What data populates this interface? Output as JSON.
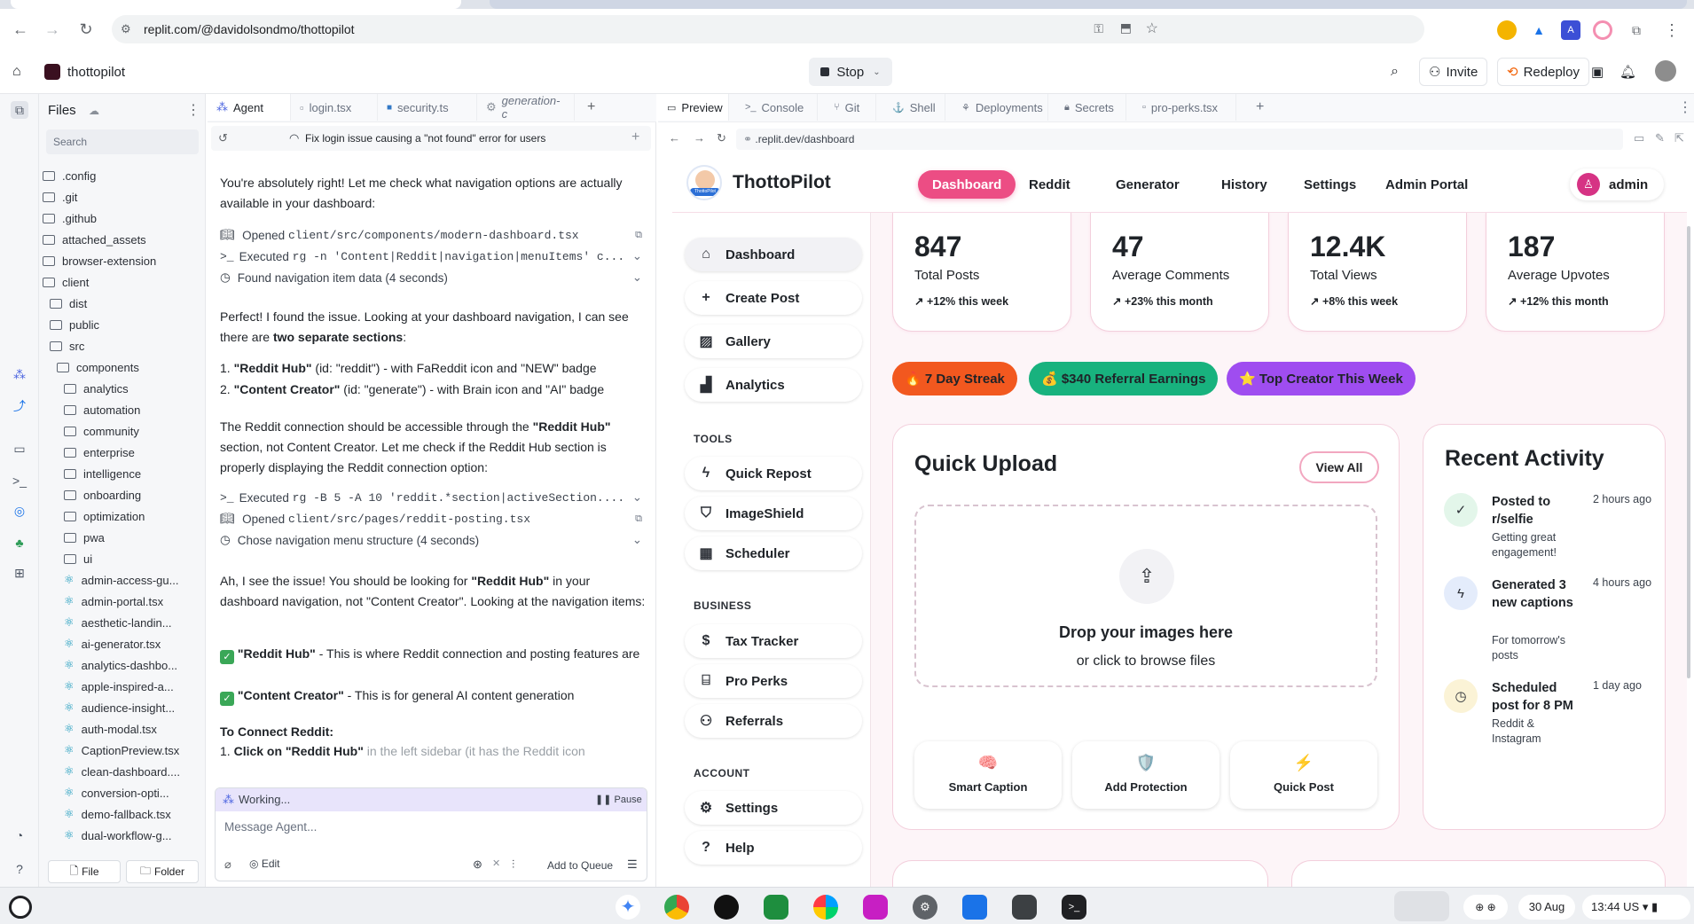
{
  "browser": {
    "url": "replit.com/@davidolsondmo/thottopilot"
  },
  "replit": {
    "project_name": "thottopilot",
    "stop_label": "Stop",
    "invite_label": "Invite",
    "redeploy_label": "Redeploy"
  },
  "files": {
    "title": "Files",
    "search_placeholder": "Search",
    "tree": [
      {
        "name": ".config",
        "type": "folder",
        "depth": 0
      },
      {
        "name": ".git",
        "type": "folder",
        "depth": 0
      },
      {
        "name": ".github",
        "type": "folder",
        "depth": 0
      },
      {
        "name": "attached_assets",
        "type": "folder",
        "depth": 0
      },
      {
        "name": "browser-extension",
        "type": "folder",
        "depth": 0
      },
      {
        "name": "client",
        "type": "folder",
        "depth": 0
      },
      {
        "name": "dist",
        "type": "folder",
        "depth": 1
      },
      {
        "name": "public",
        "type": "folder",
        "depth": 1
      },
      {
        "name": "src",
        "type": "folder",
        "depth": 1
      },
      {
        "name": "components",
        "type": "folder",
        "depth": 2
      },
      {
        "name": "analytics",
        "type": "folder",
        "depth": 3
      },
      {
        "name": "automation",
        "type": "folder",
        "depth": 3
      },
      {
        "name": "community",
        "type": "folder",
        "depth": 3
      },
      {
        "name": "enterprise",
        "type": "folder",
        "depth": 3
      },
      {
        "name": "intelligence",
        "type": "folder",
        "depth": 3
      },
      {
        "name": "onboarding",
        "type": "folder",
        "depth": 3
      },
      {
        "name": "optimization",
        "type": "folder",
        "depth": 3
      },
      {
        "name": "pwa",
        "type": "folder",
        "depth": 3
      },
      {
        "name": "ui",
        "type": "folder",
        "depth": 3
      },
      {
        "name": "admin-access-gu...",
        "type": "file",
        "depth": 3
      },
      {
        "name": "admin-portal.tsx",
        "type": "file",
        "depth": 3
      },
      {
        "name": "aesthetic-landin...",
        "type": "file",
        "depth": 3
      },
      {
        "name": "ai-generator.tsx",
        "type": "file",
        "depth": 3
      },
      {
        "name": "analytics-dashbo...",
        "type": "file",
        "depth": 3
      },
      {
        "name": "apple-inspired-a...",
        "type": "file",
        "depth": 3
      },
      {
        "name": "audience-insight...",
        "type": "file",
        "depth": 3
      },
      {
        "name": "auth-modal.tsx",
        "type": "file",
        "depth": 3
      },
      {
        "name": "CaptionPreview.tsx",
        "type": "file",
        "depth": 3
      },
      {
        "name": "clean-dashboard....",
        "type": "file",
        "depth": 3
      },
      {
        "name": "conversion-opti...",
        "type": "file",
        "depth": 3
      },
      {
        "name": "demo-fallback.tsx",
        "type": "file",
        "depth": 3
      },
      {
        "name": "dual-workflow-g...",
        "type": "file",
        "depth": 3
      }
    ],
    "file_button": "File",
    "folder_button": "Folder"
  },
  "agent": {
    "tabs": [
      "Agent",
      "login.tsx",
      "security.ts",
      "generation-c"
    ],
    "thread_title": "Fix login issue causing a \"not found\" error for users",
    "p1": "You're absolutely right! Let me check what navigation options are actually available in your dashboard:",
    "step1_prefix": "Opened",
    "step1_code": "client/src/components/modern-dashboard.tsx",
    "step2_prefix": "Executed",
    "step2_code": "rg -n 'Content|Reddit|navigation|menuItems' c...",
    "step3": "Found navigation item data (4 seconds)",
    "p2a": "Perfect! I found the issue. Looking at your dashboard navigation, I can see there are ",
    "p2b": "two separate sections",
    "p2c": ":",
    "li1a": "1. ",
    "li1b": "\"Reddit Hub\"",
    "li1c": " (id: \"reddit\") - with FaReddit icon and \"NEW\" badge",
    "li2a": "2. ",
    "li2b": "\"Content Creator\"",
    "li2c": " (id: \"generate\") - with Brain icon and \"AI\" badge",
    "p3a": "The Reddit connection should be accessible through the ",
    "p3b": "\"Reddit Hub\"",
    "p3c": " section, not Content Creator. Let me check if the Reddit Hub section is properly displaying the Reddit connection option:",
    "step4_prefix": "Executed",
    "step4_code": "rg -B 5 -A 10 'reddit.*section|activeSection....",
    "step5_prefix": "Opened",
    "step5_code": "client/src/pages/reddit-posting.tsx",
    "step6": "Chose navigation menu structure (4 seconds)",
    "p4a": "Ah, I see the issue! You should be looking for ",
    "p4b": "\"Reddit Hub\"",
    "p4c": " in your dashboard navigation, not \"Content Creator\". Looking at the navigation items:",
    "c1b": "\"Reddit Hub\"",
    "c1c": " - This is where Reddit connection and posting features are",
    "c2b": "\"Content Creator\"",
    "c2c": " - This is for general AI content generation",
    "h_connect": "To Connect Reddit:",
    "li3a": "1. ",
    "li3b": "Click on \"Reddit Hub\"",
    "li3c": " in the left sidebar (it has the Reddit icon",
    "working": "Working...",
    "pause": "Pause",
    "input_placeholder": "Message Agent...",
    "edit": "Edit",
    "add_to_queue": "Add to Queue"
  },
  "preview_tabs": [
    "Preview",
    "Console",
    "Git",
    "Shell",
    "Deployments",
    "Secrets",
    "pro-perks.tsx"
  ],
  "preview_url": ".replit.dev/dashboard",
  "app": {
    "logo_text": "ThottoPilot",
    "logo_mark": "ThottoPilot",
    "nav": [
      "Dashboard",
      "Reddit",
      "Generator",
      "History",
      "Settings",
      "Admin Portal"
    ],
    "user": "admin",
    "sidebar_main": [
      "Dashboard",
      "Create Post",
      "Gallery",
      "Analytics"
    ],
    "tools_heading": "TOOLS",
    "sidebar_tools": [
      "Quick Repost",
      "ImageShield",
      "Scheduler"
    ],
    "business_heading": "BUSINESS",
    "sidebar_business": [
      "Tax Tracker",
      "Pro Perks",
      "Referrals"
    ],
    "account_heading": "ACCOUNT",
    "sidebar_account": [
      "Settings",
      "Help"
    ],
    "stats": [
      {
        "value": "847",
        "label": "Total Posts",
        "change": "+12% this week"
      },
      {
        "value": "47",
        "label": "Average Comments",
        "change": "+23% this month"
      },
      {
        "value": "12.4K",
        "label": "Total Views",
        "change": "+8% this week"
      },
      {
        "value": "187",
        "label": "Average Upvotes",
        "change": "+12% this month"
      }
    ],
    "badges": [
      "🔥 7 Day Streak",
      "💰 $340 Referral Earnings",
      "⭐ Top Creator This Week"
    ],
    "quick_upload": {
      "title": "Quick Upload",
      "view_all": "View All",
      "drop_title": "Drop your images here",
      "drop_sub": "or click to browse files",
      "actions": [
        {
          "emoji": "🧠",
          "label": "Smart Caption"
        },
        {
          "emoji": "🛡️",
          "label": "Add Protection"
        },
        {
          "emoji": "⚡",
          "label": "Quick Post"
        }
      ]
    },
    "recent": {
      "title": "Recent Activity",
      "items": [
        {
          "title": "Posted to r/selfie",
          "sub": "Getting great engagement!",
          "time": "2 hours ago"
        },
        {
          "title": "Generated 3 new captions",
          "sub": "For tomorrow's posts",
          "time": "4 hours ago"
        },
        {
          "title": "Scheduled post for 8 PM",
          "sub": "Reddit & Instagram",
          "time": "1 day ago"
        }
      ]
    }
  },
  "taskbar": {
    "date": "30 Aug",
    "time": "13:44",
    "locale": "US"
  }
}
